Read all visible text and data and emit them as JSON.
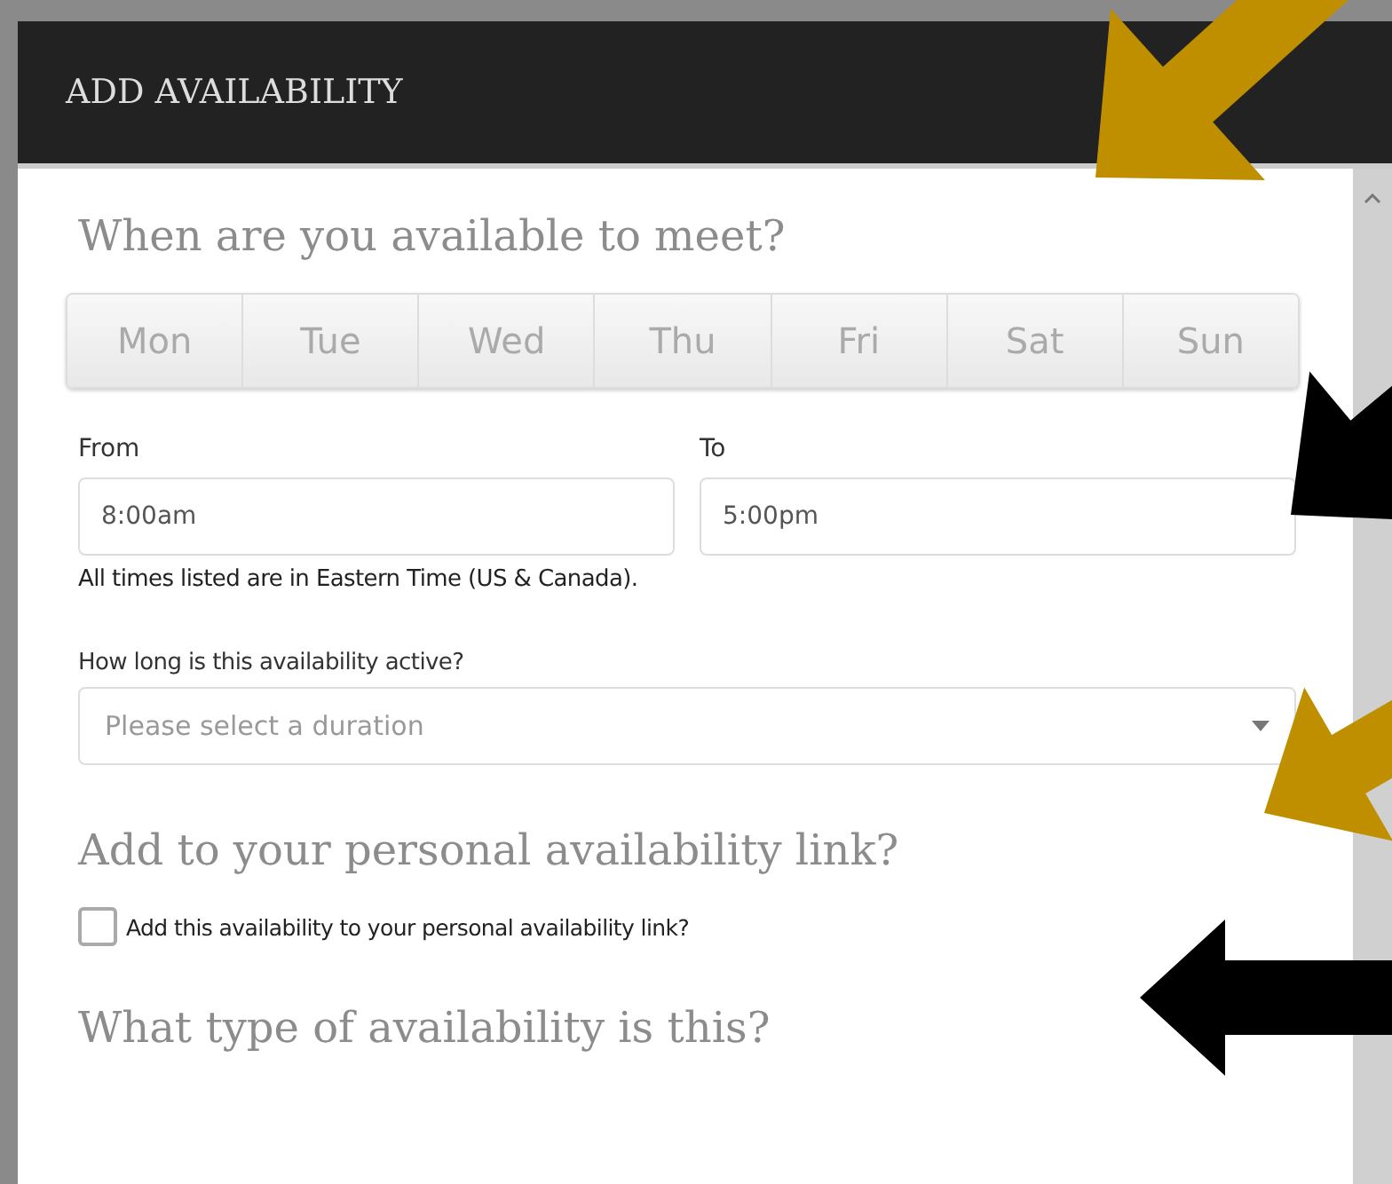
{
  "dialog": {
    "title": "ADD AVAILABILITY"
  },
  "sections": [
    {
      "kind": "days",
      "heading": "When are you available to meet?",
      "days": [
        {
          "label": "Mon",
          "selected": false
        },
        {
          "label": "Tue",
          "selected": false
        },
        {
          "label": "Wed",
          "selected": false
        },
        {
          "label": "Thu",
          "selected": false
        },
        {
          "label": "Fri",
          "selected": false
        },
        {
          "label": "Sat",
          "selected": false
        },
        {
          "label": "Sun",
          "selected": false
        }
      ],
      "from": {
        "label": "From",
        "value": "8:00am"
      },
      "to": {
        "label": "To",
        "value": "5:00pm"
      },
      "note": "All times listed are in Eastern Time (US & Canada).",
      "duration": {
        "label": "How long is this availability active?",
        "placeholder": "Please select a duration"
      }
    },
    {
      "kind": "checkbox",
      "heading": "Add to your personal availability link?",
      "label": "Add this availability to your personal availability link?",
      "checked": false
    },
    {
      "kind": "heading",
      "heading": "What type of availability is this?"
    }
  ]
}
